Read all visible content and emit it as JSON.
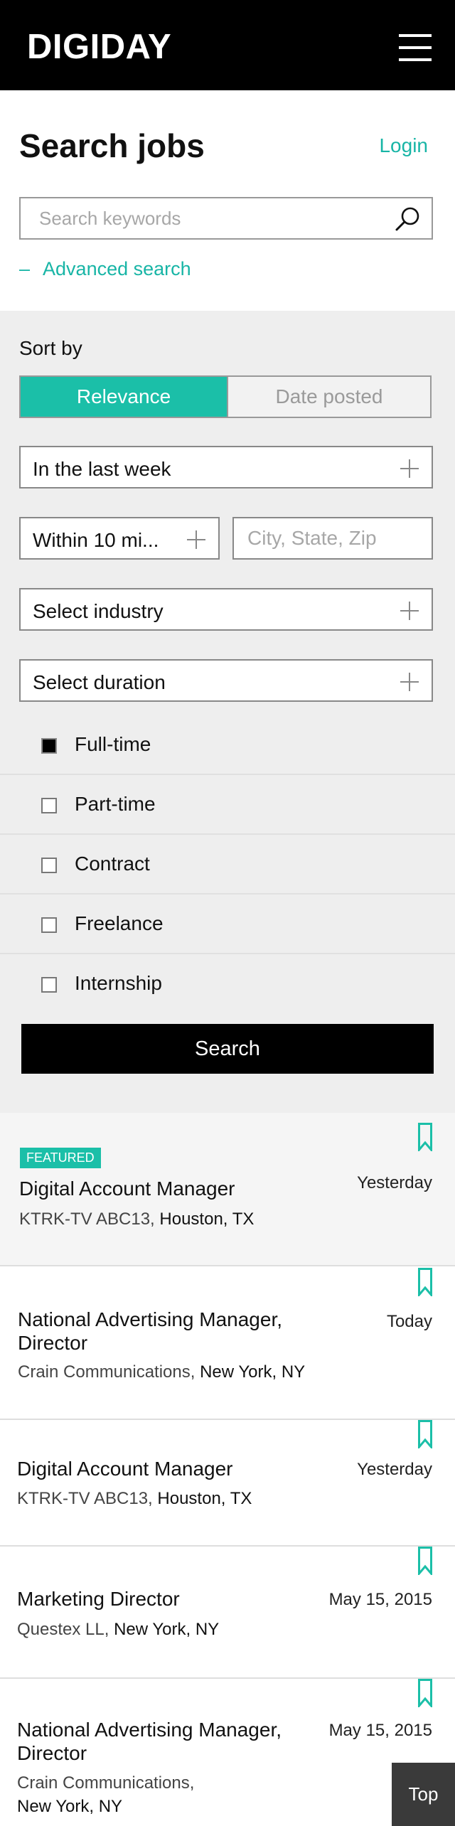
{
  "header": {
    "logo": "DIGIDAY",
    "menu_icon": "hamburger-menu-icon"
  },
  "search": {
    "title": "Search jobs",
    "login": "Login",
    "keyword_placeholder": "Search keywords",
    "search_icon": "magnifier-icon",
    "advanced_toggle": "–",
    "advanced_label": "Advanced search"
  },
  "filters": {
    "sort_label": "Sort by",
    "sort_options": [
      "Relevance",
      "Date posted"
    ],
    "sort_selected": "Relevance",
    "period": "In the last week",
    "radius": "Within 10 mi...",
    "location_placeholder": "City, State, Zip",
    "industry": "Select industry",
    "duration": "Select duration",
    "job_types": [
      {
        "label": "Full-time",
        "checked": true
      },
      {
        "label": "Part-time",
        "checked": false
      },
      {
        "label": "Contract",
        "checked": false
      },
      {
        "label": "Freelance",
        "checked": false
      },
      {
        "label": "Internship",
        "checked": false
      }
    ],
    "search_button": "Search"
  },
  "jobs": [
    {
      "featured_badge": "FEATURED",
      "title_lines": [
        "Digital Account Manager"
      ],
      "date": "Yesterday",
      "company": "KTRK-TV ABC13,",
      "location": "Houston, TX"
    },
    {
      "title_lines": [
        "National Advertising Manager,",
        "Director"
      ],
      "date": "Today",
      "company": "Crain Communications,",
      "location": "New York, NY"
    },
    {
      "title_lines": [
        "Digital Account Manager"
      ],
      "date": "Yesterday",
      "company": "KTRK-TV ABC13,",
      "location": "Houston, TX"
    },
    {
      "title_lines": [
        "Marketing Director"
      ],
      "date": "May 15, 2015",
      "company": "Questex LL,",
      "location": "New York, NY"
    },
    {
      "title_lines": [
        "National Advertising Manager,",
        "Director"
      ],
      "date": "May 15, 2015",
      "company": "Crain Communications,",
      "location": "New York, NY"
    }
  ],
  "bookmark_icon": "bookmark-icon",
  "top_button": "Top",
  "colors": {
    "accent": "#1bbfa8",
    "header_bg": "#000000",
    "filter_bg": "#eeeeee"
  }
}
